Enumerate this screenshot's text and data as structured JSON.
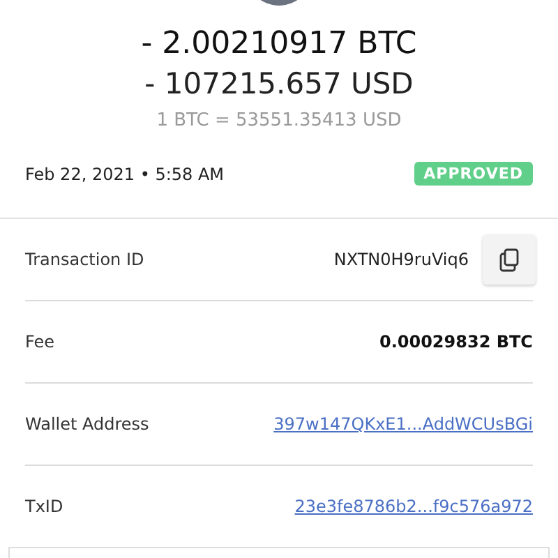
{
  "amount_crypto": "- 2.00210917 BTC",
  "amount_fiat": "- 107215.657 USD",
  "rate": "1 BTC = 53551.35413 USD",
  "date": "Feb 22, 2021 • 5:58 AM",
  "status": {
    "label": "APPROVED",
    "color": "#5fcf8a"
  },
  "details": [
    {
      "kind": "copy",
      "label": "Transaction ID",
      "value": "NXTN0H9ruViq6"
    },
    {
      "kind": "plain",
      "label": "Fee",
      "value": "0.00029832 BTC"
    },
    {
      "kind": "link",
      "label": "Wallet Address",
      "value": "397w147QKxE1...AddWCUsBGi"
    },
    {
      "kind": "link",
      "label": "TxID",
      "value": "23e3fe8786b2...f9c576a972"
    }
  ]
}
